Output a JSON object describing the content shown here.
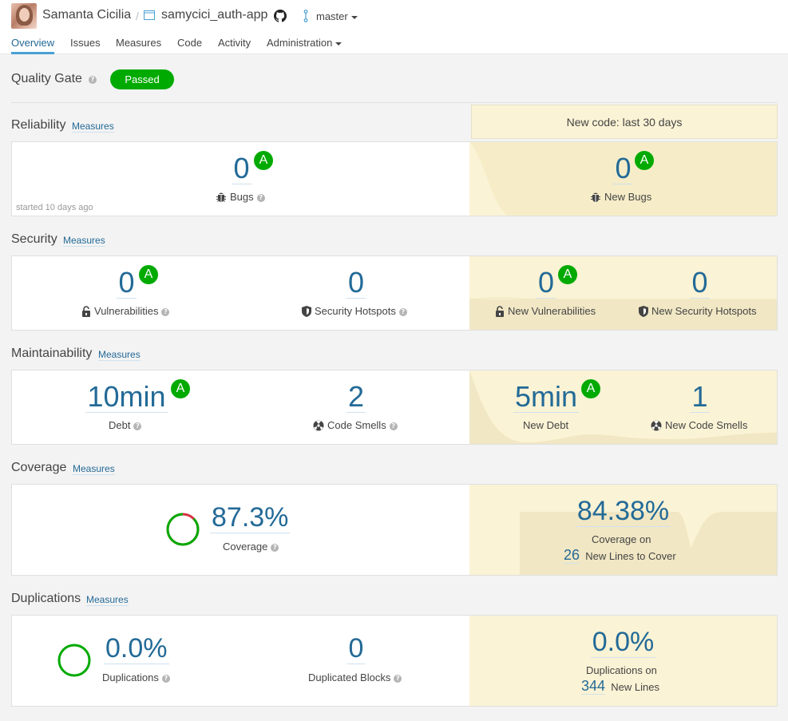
{
  "header": {
    "organization": "Samanta Cicilia",
    "separator": "/",
    "project": "samycici_auth-app",
    "branch": "master"
  },
  "nav": {
    "tabs": [
      "Overview",
      "Issues",
      "Measures",
      "Code",
      "Activity",
      "Administration"
    ],
    "active": "Overview"
  },
  "quality_gate": {
    "title": "Quality Gate",
    "status": "Passed",
    "status_color": "#00aa00"
  },
  "new_code": {
    "label": "New code: last 30 days"
  },
  "measures_link": "Measures",
  "help_glyph": "?",
  "reliability": {
    "title": "Reliability",
    "bugs": {
      "value": "0",
      "rating": "A",
      "label": "Bugs"
    },
    "started": "started 10 days ago",
    "new_bugs": {
      "value": "0",
      "rating": "A",
      "label": "New Bugs"
    }
  },
  "security": {
    "title": "Security",
    "vulnerabilities": {
      "value": "0",
      "rating": "A",
      "label": "Vulnerabilities"
    },
    "hotspots": {
      "value": "0",
      "label": "Security Hotspots"
    },
    "new_vulnerabilities": {
      "value": "0",
      "rating": "A",
      "label": "New Vulnerabilities"
    },
    "new_hotspots": {
      "value": "0",
      "label": "New Security Hotspots"
    }
  },
  "maintainability": {
    "title": "Maintainability",
    "debt": {
      "value": "10min",
      "rating": "A",
      "label": "Debt"
    },
    "smells": {
      "value": "2",
      "label": "Code Smells"
    },
    "new_debt": {
      "value": "5min",
      "rating": "A",
      "label": "New Debt"
    },
    "new_smells": {
      "value": "1",
      "label": "New Code Smells"
    }
  },
  "coverage": {
    "title": "Coverage",
    "value": "87.3%",
    "fraction": 0.873,
    "label": "Coverage",
    "new_value": "84.38%",
    "new_label": "Coverage on",
    "new_lines": "26",
    "new_lines_label": "New Lines to Cover"
  },
  "duplications": {
    "title": "Duplications",
    "value": "0.0%",
    "label": "Duplications",
    "blocks": {
      "value": "0",
      "label": "Duplicated Blocks"
    },
    "new_value": "0.0%",
    "new_label": "Duplications on",
    "new_lines": "344",
    "new_lines_label": "New Lines"
  },
  "colors": {
    "link": "#236a97",
    "good": "#00aa00",
    "bad": "#d4333f",
    "new_code_bg": "#fbf3d5"
  }
}
